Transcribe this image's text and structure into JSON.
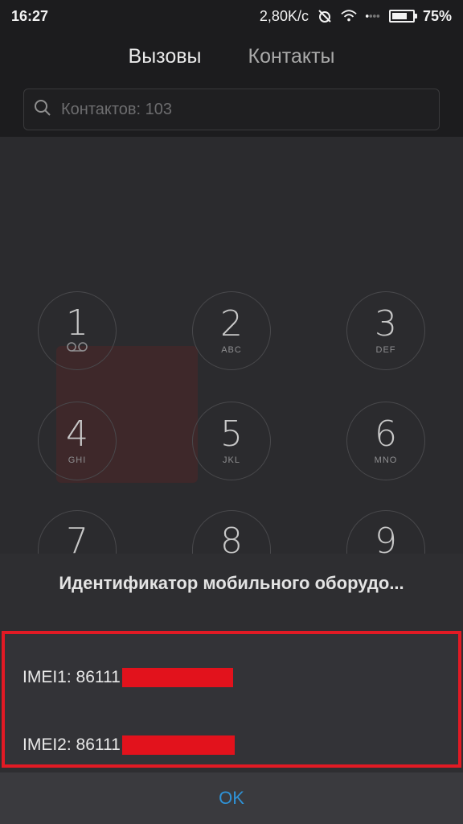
{
  "status_bar": {
    "time": "16:27",
    "network_speed": "2,80K/с",
    "battery_percent": "75%",
    "battery_level": 0.75,
    "icons": [
      "alarm-off-icon",
      "wifi-icon",
      "signal-icon",
      "battery-icon"
    ]
  },
  "tabs": [
    {
      "label": "Вызовы",
      "active": true
    },
    {
      "label": "Контакты",
      "active": false
    }
  ],
  "search": {
    "placeholder": "Контактов: 103",
    "icon": "search-icon"
  },
  "dialpad": [
    {
      "digit": "1",
      "letters": "voicemail"
    },
    {
      "digit": "2",
      "letters": "ABC"
    },
    {
      "digit": "3",
      "letters": "DEF"
    },
    {
      "digit": "4",
      "letters": "GHI"
    },
    {
      "digit": "5",
      "letters": "JKL"
    },
    {
      "digit": "6",
      "letters": "MNO"
    },
    {
      "digit": "7",
      "letters": ""
    },
    {
      "digit": "8",
      "letters": ""
    },
    {
      "digit": "9",
      "letters": ""
    }
  ],
  "dialog": {
    "title": "Идентификатор мобильного оборудо...",
    "imei1": "IMEI1: 86111",
    "imei2": "IMEI2: 86111",
    "ok_label": "OK"
  },
  "colors": {
    "highlight_border": "#e21a24",
    "ok_text": "#2f92d6"
  }
}
